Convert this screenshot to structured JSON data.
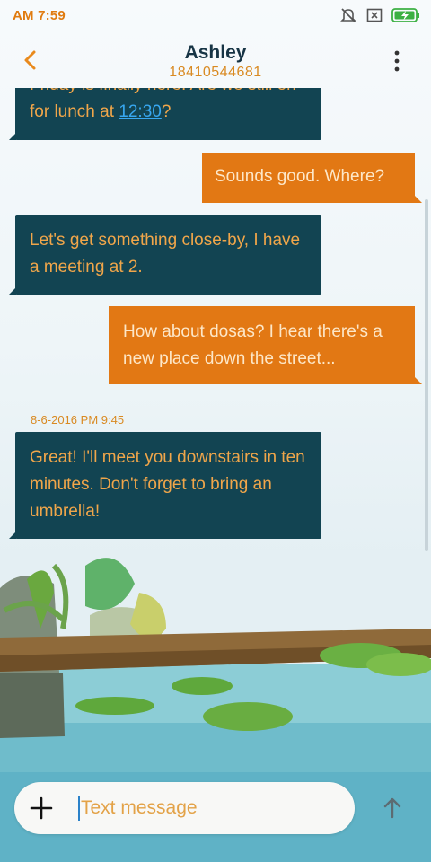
{
  "status": {
    "time": "AM 7:59"
  },
  "contact": {
    "name": "Ashley",
    "number": "18410544681"
  },
  "messages": [
    {
      "dir": "in",
      "text_prefix": "Friday is finally here. Are we still on for lunch at ",
      "link": "12:30",
      "text_suffix": "?"
    },
    {
      "dir": "out",
      "text": "Sounds good. Where?"
    },
    {
      "dir": "in",
      "text": "Let's get something close-by, I have a meeting at 2."
    },
    {
      "dir": "out",
      "text": "How about dosas? I hear there's a new place down the street..."
    },
    {
      "timestamp": "8-6-2016 PM 9:45"
    },
    {
      "dir": "in",
      "text": "Great! I'll meet you downstairs in ten minutes. Don't forget to bring an umbrella!"
    }
  ],
  "composer": {
    "placeholder": "Text message"
  },
  "colors": {
    "accent": "#e07b10",
    "incoming_bubble": "#124452",
    "outgoing_bubble": "#e27814",
    "incoming_text": "#f0a64a",
    "link": "#38a7f0"
  },
  "icons": [
    "mute-icon",
    "close-box-icon",
    "battery-charging-icon",
    "back-icon",
    "more-vert-icon",
    "plus-icon",
    "send-arrow-icon"
  ]
}
